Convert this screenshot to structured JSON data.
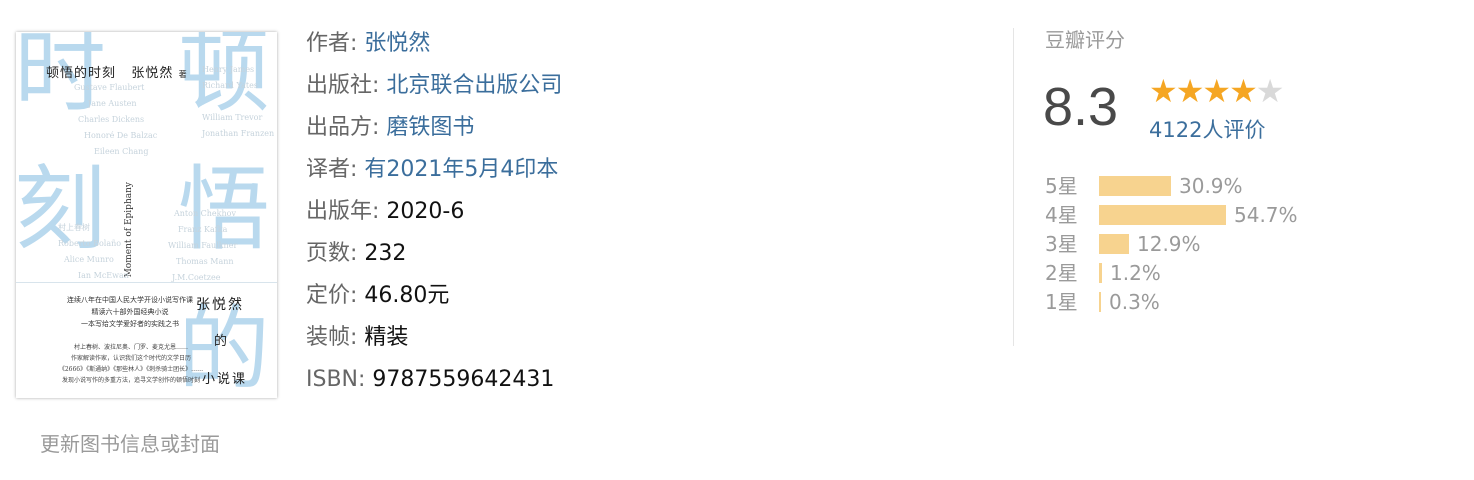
{
  "cover": {
    "big_chars": [
      "时",
      "顿",
      "刻",
      "悟",
      "的"
    ],
    "title_line": "顿悟的时刻",
    "author_line": "张悦然",
    "author_mark": "著",
    "english_title": "Moment of Epiphany",
    "names_left": [
      "Gustave Flaubert",
      "Jane Austen",
      "Charles Dickens",
      "Honoré De Balzac",
      "Eileen Chang"
    ],
    "names_right": [
      "Henry James",
      "Richard Yates",
      "William Trevor",
      "Jonathan Franzen"
    ],
    "names_left2": [
      "村上春树",
      "Roberto Bolaño",
      "Alice Munro",
      "Ian McEwan"
    ],
    "names_right2": [
      "Anton Chekhov",
      "Franz Kafka",
      "William Faulkner",
      "Thomas Mann",
      "J.M.Coetzee"
    ],
    "blurb": [
      "连续八年在中国人民大学开设小说写作课",
      "精读六十部外国经典小说",
      "一本写给文学爱好者的实践之书"
    ],
    "blurb2": [
      "村上春树、波拉尼奥、门罗、麦克尤恩……",
      "作家解读作家，认识我们这个时代的文学日历",
      "《2666》《斯通纳》《那些林人》《刺杀骑士团长》……",
      "发现小说写作的多重方法，追寻文学创作的顿悟时刻"
    ],
    "side_author": "张悦然",
    "side_chars": [
      "的",
      "小说课"
    ]
  },
  "update_link": "更新图书信息或封面",
  "info": {
    "author_label": "作者:",
    "author_value": "张悦然",
    "publisher_label": "出版社:",
    "publisher_value": "北京联合出版公司",
    "producer_label": "出品方:",
    "producer_value": "磨铁图书",
    "translator_label": "译者:",
    "translator_value": "有2021年5月4印本",
    "year_label": "出版年:",
    "year_value": "2020-6",
    "pages_label": "页数:",
    "pages_value": "232",
    "price_label": "定价:",
    "price_value": "46.80元",
    "binding_label": "装帧:",
    "binding_value": "精装",
    "isbn_label": "ISBN:",
    "isbn_value": "9787559642431"
  },
  "rating": {
    "title": "豆瓣评分",
    "score": "8.3",
    "stars_filled": 4,
    "stars_total": 5,
    "votes": "4122人评价",
    "distribution": [
      {
        "label": "5星",
        "percent": "30.9%",
        "value": 30.9
      },
      {
        "label": "4星",
        "percent": "54.7%",
        "value": 54.7
      },
      {
        "label": "3星",
        "percent": "12.9%",
        "value": 12.9
      },
      {
        "label": "2星",
        "percent": "1.2%",
        "value": 1.2
      },
      {
        "label": "1星",
        "percent": "0.3%",
        "value": 0.3
      }
    ],
    "colors": {
      "star": "#f5a623",
      "star_off": "#d9d9d9",
      "bar": "#f7d38f",
      "link": "#3b6e9c"
    }
  }
}
